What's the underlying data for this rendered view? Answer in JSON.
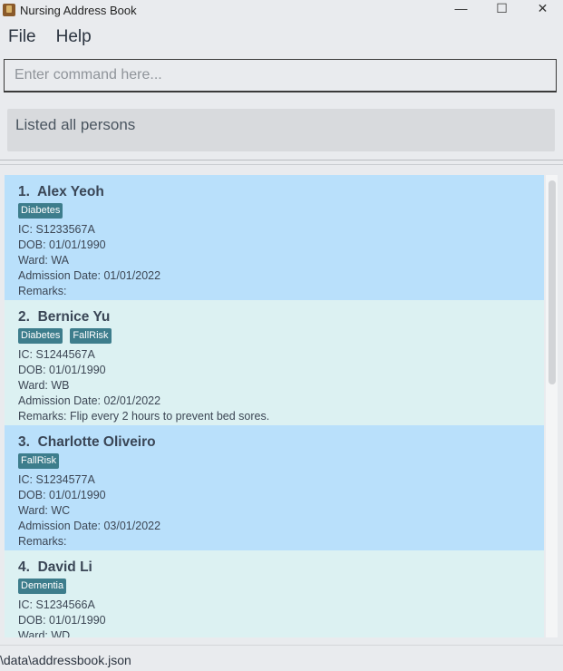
{
  "window": {
    "title": "Nursing Address Book",
    "controls": {
      "minimize": "—",
      "maximize": "☐",
      "close": "✕"
    }
  },
  "menu": {
    "file": "File",
    "help": "Help"
  },
  "command": {
    "placeholder": "Enter command here...",
    "value": ""
  },
  "result": {
    "message": "Listed all persons"
  },
  "persons": [
    {
      "index": "1.",
      "name": "Alex Yeoh",
      "tags": [
        "Diabetes"
      ],
      "ic": "IC: S1233567A",
      "dob": "DOB: 01/01/1990",
      "ward": "Ward: WA",
      "admission": "Admission Date: 01/01/2022",
      "remarks": "Remarks:"
    },
    {
      "index": "2.",
      "name": "Bernice Yu",
      "tags": [
        "Diabetes",
        "FallRisk"
      ],
      "ic": "IC: S1244567A",
      "dob": "DOB: 01/01/1990",
      "ward": "Ward: WB",
      "admission": "Admission Date: 02/01/2022",
      "remarks": "Remarks: Flip every 2 hours to prevent bed sores."
    },
    {
      "index": "3.",
      "name": "Charlotte Oliveiro",
      "tags": [
        "FallRisk"
      ],
      "ic": "IC: S1234577A",
      "dob": "DOB: 01/01/1990",
      "ward": "Ward: WC",
      "admission": "Admission Date: 03/01/2022",
      "remarks": "Remarks:"
    },
    {
      "index": "4.",
      "name": "David Li",
      "tags": [
        "Dementia"
      ],
      "ic": "IC: S1234566A",
      "dob": "DOB: 01/01/1990",
      "ward": "Ward: WD",
      "admission": "",
      "remarks": ""
    }
  ],
  "status": {
    "path": "\\data\\addressbook.json"
  },
  "colors": {
    "card_odd": "#b9e0fb",
    "card_even": "#dcf1f2",
    "tag": "#3d7d8c"
  }
}
